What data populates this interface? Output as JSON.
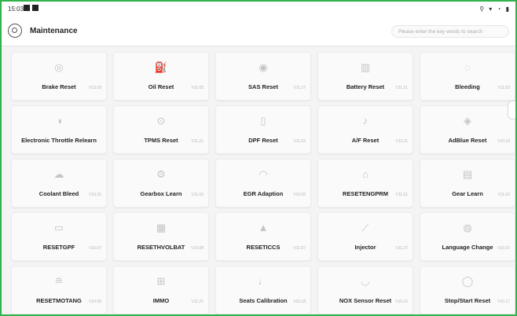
{
  "statusbar": {
    "time": "15:03",
    "icons": "⚲ ▾ ◔ ▮"
  },
  "header": {
    "title": "Maintenance",
    "search_placeholder": "Please enter the key words to search"
  },
  "tiles": [
    {
      "label": "Brake Reset",
      "version": "V13.09",
      "icon": "brake-icon",
      "glyph": "◎"
    },
    {
      "label": "Oil Reset",
      "version": "V11.05",
      "icon": "oil-can-icon",
      "glyph": "⛽"
    },
    {
      "label": "SAS Reset",
      "version": "V11.27",
      "icon": "steering-wheel-icon",
      "glyph": "◉"
    },
    {
      "label": "Battery Reset",
      "version": "V11.21",
      "icon": "battery-icon",
      "glyph": "▥"
    },
    {
      "label": "Bleeding",
      "version": "V11.03",
      "icon": "bleeding-icon",
      "glyph": "◌"
    },
    {
      "label": "Electronic Throttle Relearn",
      "version": "",
      "icon": "throttle-icon",
      "glyph": "◑"
    },
    {
      "label": "TPMS Reset",
      "version": "V11.21",
      "icon": "tire-pressure-icon",
      "glyph": "⊙"
    },
    {
      "label": "DPF Reset",
      "version": "V11.03",
      "icon": "dpf-icon",
      "glyph": "▯"
    },
    {
      "label": "A/F Reset",
      "version": "V10.11",
      "icon": "af-sensor-icon",
      "glyph": "♪"
    },
    {
      "label": "AdBlue Reset",
      "version": "V10.18",
      "icon": "adblue-icon",
      "glyph": "◈"
    },
    {
      "label": "Coolant Bleed",
      "version": "V10.15",
      "icon": "coolant-icon",
      "glyph": "☁"
    },
    {
      "label": "Gearbox Learn",
      "version": "V11.03",
      "icon": "gearbox-icon",
      "glyph": "⚙"
    },
    {
      "label": "EGR Adaption",
      "version": "V10.09",
      "icon": "egr-icon",
      "glyph": "◠"
    },
    {
      "label": "RESETENGPRM",
      "version": "V11.01",
      "icon": "engine-icon",
      "glyph": "⌂"
    },
    {
      "label": "Gear Learn",
      "version": "V11.03",
      "icon": "gear-learn-icon",
      "glyph": "▤"
    },
    {
      "label": "RESETGPF",
      "version": "V10.07",
      "icon": "gpf-icon",
      "glyph": "▭"
    },
    {
      "label": "RESETHVOLBAT",
      "version": "V10.08",
      "icon": "hv-battery-icon",
      "glyph": "▦"
    },
    {
      "label": "RESETICCS",
      "version": "V11.07",
      "icon": "iccs-icon",
      "glyph": "▲"
    },
    {
      "label": "Injector",
      "version": "V11.27",
      "icon": "injector-icon",
      "glyph": "⟋"
    },
    {
      "label": "Language Change",
      "version": "V10.21",
      "icon": "language-icon",
      "glyph": "◍"
    },
    {
      "label": "RESETMOTANG",
      "version": "V10.08",
      "icon": "motor-angle-icon",
      "glyph": "≘"
    },
    {
      "label": "IMMO",
      "version": "V11.21",
      "icon": "immo-key-icon",
      "glyph": "⊞"
    },
    {
      "label": "Seats Calibration",
      "version": "V10.18",
      "icon": "seat-icon",
      "glyph": "♩"
    },
    {
      "label": "NOX Sensor Reset",
      "version": "V10.16",
      "icon": "nox-sensor-icon",
      "glyph": "◡"
    },
    {
      "label": "Stop/Start Reset",
      "version": "V10.17",
      "icon": "stop-start-icon",
      "glyph": "◯"
    }
  ]
}
